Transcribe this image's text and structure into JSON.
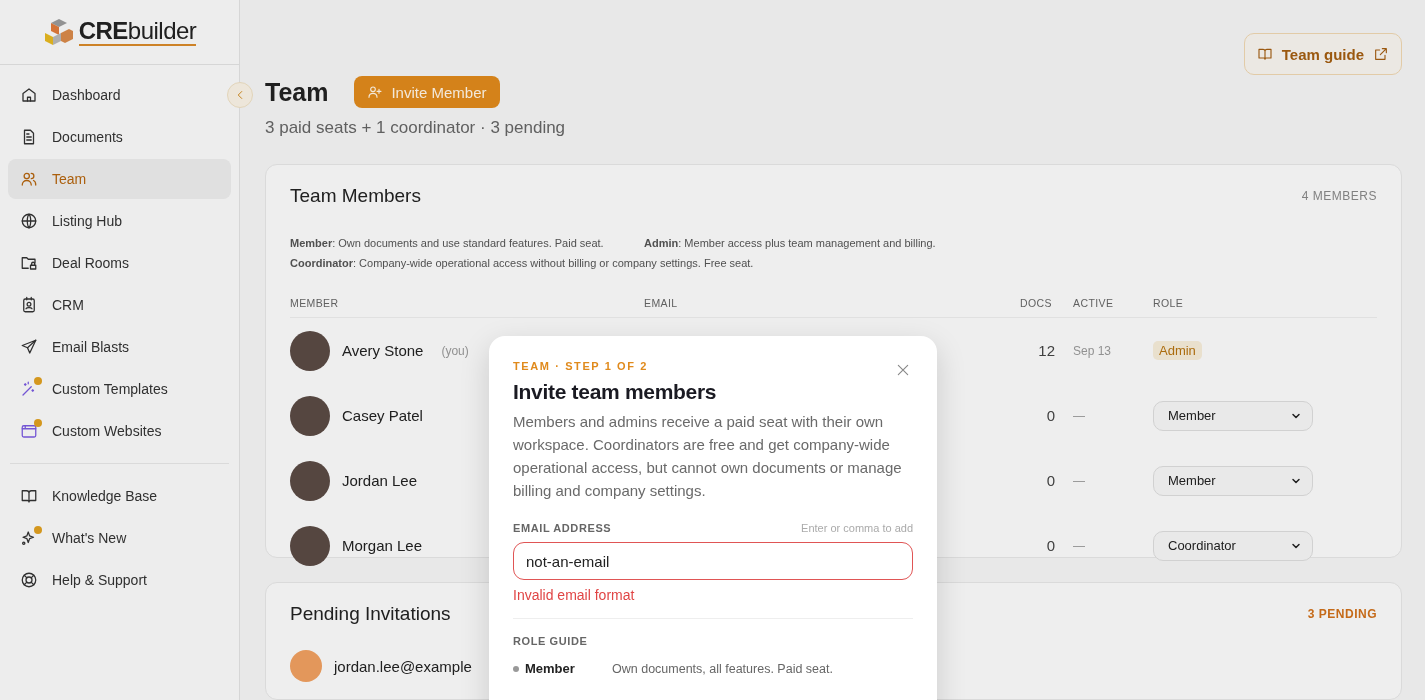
{
  "brand": {
    "bold": "CRE",
    "rest": "builder"
  },
  "nav": [
    [
      {
        "label": "Dashboard",
        "selected": false,
        "dot": false
      },
      {
        "label": "Documents",
        "selected": false,
        "dot": false
      },
      {
        "label": "Team",
        "selected": true,
        "dot": false
      },
      {
        "label": "Listing Hub",
        "selected": false,
        "dot": false
      },
      {
        "label": "Deal Rooms",
        "selected": false,
        "dot": false
      },
      {
        "label": "CRM",
        "selected": false,
        "dot": false
      },
      {
        "label": "Email Blasts",
        "selected": false,
        "dot": false
      },
      {
        "label": "Custom Templates",
        "selected": false,
        "dot": true
      },
      {
        "label": "Custom Websites",
        "selected": false,
        "dot": true
      }
    ],
    [
      {
        "label": "Knowledge Base",
        "selected": false,
        "dot": false
      },
      {
        "label": "What's New",
        "selected": false,
        "dot": true
      },
      {
        "label": "Help & Support",
        "selected": false,
        "dot": false
      }
    ]
  ],
  "header": {
    "title": "Team",
    "invite_button": "Invite Member",
    "subtitle": "3 paid seats + 1 coordinator · 3 pending",
    "guide_button": "Team guide"
  },
  "members_card": {
    "title": "Team Members",
    "count": "4 MEMBERS",
    "legend": [
      "**Member**: Own documents and use standard features. Paid seat.",
      "**Admin**: Member access plus team management and billing.",
      "**Coordinator**: Company-wide operational access without billing or company settings. Free seat."
    ],
    "columns": [
      "MEMBER",
      "EMAIL",
      "DOCS",
      "ACTIVE",
      "ROLE"
    ],
    "rows": [
      {
        "name": "Avery Stone",
        "you": "(you)",
        "docs": "12",
        "active": "Sep 13",
        "role": "Admin",
        "kind": "badge"
      },
      {
        "name": "Casey Patel",
        "docs": "0",
        "active": "—",
        "role": "Member",
        "kind": "select"
      },
      {
        "name": "Jordan Lee",
        "docs": "0",
        "active": "—",
        "role": "Member",
        "kind": "select"
      },
      {
        "name": "Morgan Lee",
        "docs": "0",
        "active": "—",
        "role": "Coordinator",
        "kind": "select"
      }
    ]
  },
  "pending_card": {
    "title": "Pending Invitations",
    "count": "3 PENDING",
    "rows": [
      {
        "email": "jordan.lee@example"
      }
    ]
  },
  "modal": {
    "eyebrow": "TEAM · STEP 1 OF 2",
    "title": "Invite team members",
    "description": "Members and admins receive a paid seat with their own workspace. Coordinators are free and get company-wide operational access, but cannot own documents or manage billing and company settings.",
    "email_label": "EMAIL ADDRESS",
    "email_hint": "Enter or comma to add",
    "email_value": "not-an-email",
    "invalid": true,
    "error": "Invalid email format",
    "role_guide_label": "ROLE GUIDE",
    "roles": [
      {
        "name": "Member",
        "description": "Own documents, all features. Paid seat."
      }
    ]
  }
}
